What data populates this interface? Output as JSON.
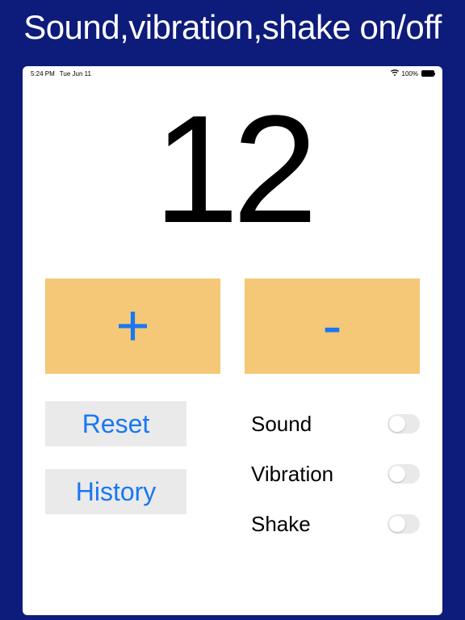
{
  "header": {
    "title": "Sound,vibration,shake on/off"
  },
  "status_bar": {
    "time": "5:24 PM",
    "date": "Tue Jun 11",
    "battery_pct": "100%"
  },
  "counter": {
    "value": "12"
  },
  "buttons": {
    "plus": "+",
    "minus": "-",
    "reset": "Reset",
    "history": "History"
  },
  "settings": {
    "sound": {
      "label": "Sound",
      "on": false
    },
    "vibration": {
      "label": "Vibration",
      "on": false
    },
    "shake": {
      "label": "Shake",
      "on": false
    }
  }
}
